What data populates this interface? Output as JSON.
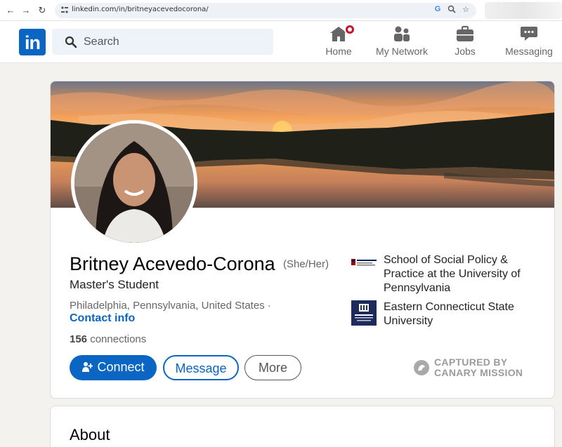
{
  "browser": {
    "url": "linkedin.com/in/britneyacevedocorona/",
    "back_icon": "arrow-left",
    "forward_icon": "arrow-right",
    "reload_icon": "reload"
  },
  "header": {
    "logo_text": "in",
    "search_placeholder": "Search",
    "nav": [
      {
        "label": "Home",
        "icon": "home-icon"
      },
      {
        "label": "My Network",
        "icon": "network-icon"
      },
      {
        "label": "Jobs",
        "icon": "briefcase-icon"
      },
      {
        "label": "Messaging",
        "icon": "chat-icon"
      }
    ]
  },
  "profile": {
    "name": "Britney Acevedo-Corona",
    "pronouns": "(She/Her)",
    "headline": "Master's Student",
    "location": "Philadelphia, Pennsylvania, United States ·",
    "contact_info": "Contact info",
    "connections_count": "156",
    "connections_label": "connections",
    "buttons": {
      "connect": "Connect",
      "message": "Message",
      "more": "More"
    },
    "education": [
      {
        "name": "School of Social Policy & Practice at the University of Pennsylvania",
        "logo": "penn-logo"
      },
      {
        "name": "Eastern Connecticut State University",
        "logo": "ecsu-logo"
      }
    ]
  },
  "watermark": {
    "line1": "CAPTURED BY",
    "line2": "CANARY MISSION"
  },
  "about": {
    "title": "About"
  },
  "colors": {
    "linkedin_blue": "#0a66c2",
    "background": "#f4f2ee",
    "notification_red": "#cb112d"
  }
}
